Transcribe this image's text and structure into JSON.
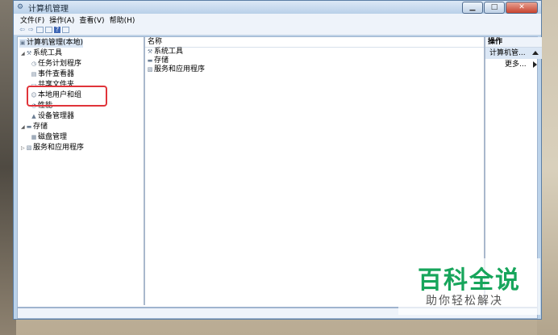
{
  "window": {
    "title": "计算机管理",
    "controls": {
      "minimize": "▁",
      "maximize": "□",
      "close": "✕"
    }
  },
  "menubar": [
    {
      "label": "文件(F)"
    },
    {
      "label": "操作(A)"
    },
    {
      "label": "查看(V)"
    },
    {
      "label": "帮助(H)"
    }
  ],
  "toolbar": {
    "icons": [
      "back-icon",
      "forward-icon",
      "show-hide-tree-icon",
      "properties-icon",
      "help-icon",
      "show-action-pane-icon"
    ]
  },
  "tree": {
    "root": "计算机管理(本地)",
    "system_tools": "系统工具",
    "task_scheduler": "任务计划程序",
    "event_viewer": "事件查看器",
    "shared_folders": "共享文件夹",
    "local_users_groups": "本地用户和组",
    "performance": "性能",
    "device_manager": "设备管理器",
    "storage": "存储",
    "disk_management": "磁盘管理",
    "services_apps": "服务和应用程序"
  },
  "center": {
    "column_header": "名称",
    "items": [
      "系统工具",
      "存储",
      "服务和应用程序"
    ]
  },
  "actions": {
    "header": "操作",
    "section": "计算机管...",
    "more": "更多..."
  },
  "watermark": {
    "title": "百科全说",
    "subtitle": "助你轻松解决"
  },
  "colors": {
    "highlight_border": "#e0343a",
    "watermark_green": "#17a55b",
    "selection_bg": "#dbe7f5"
  }
}
